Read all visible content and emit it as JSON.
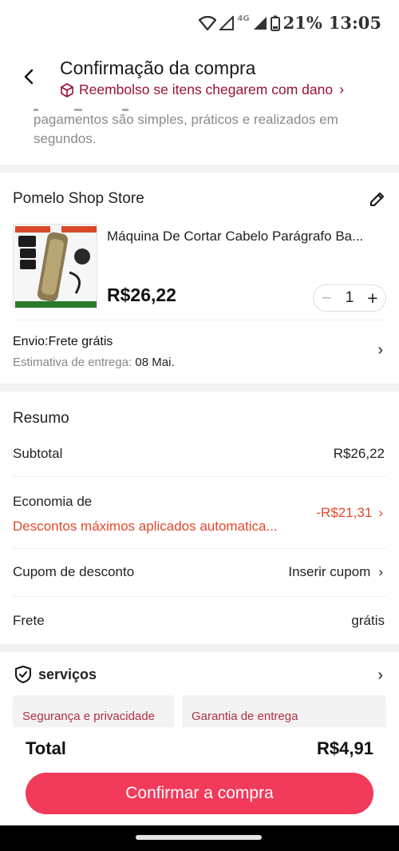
{
  "status_bar": {
    "network": "4G",
    "battery": "21%",
    "time": "13:05"
  },
  "header": {
    "title": "Confirmação da compra",
    "refund_notice": "Reembolso se itens chegarem com dano",
    "accent_color": "#9b1035"
  },
  "payment_info": {
    "text": "pagamentos são simples, práticos e realizados em segundos."
  },
  "store": {
    "name": "Pomelo Shop Store",
    "product": {
      "name": "Máquina De Cortar Cabelo Parágrafo Ba...",
      "price": "R$26,22",
      "quantity": "1"
    },
    "shipping": {
      "title": "Envio:Frete grátis",
      "estimate_label": "Estimativa de entrega:",
      "estimate_date": "08 Mai."
    }
  },
  "summary": {
    "title": "Resumo",
    "subtotal_label": "Subtotal",
    "subtotal_value": "R$26,22",
    "savings_label": "Economia de",
    "discount_text": "Descontos máximos aplicados automatica...",
    "discount_value": "-R$21,31",
    "coupon_label": "Cupom de desconto",
    "coupon_value": "Inserir cupom",
    "shipping_label": "Frete",
    "shipping_value": "grátis",
    "discount_color": "#e4472b"
  },
  "services": {
    "title": "serviços",
    "cards": [
      "Segurança e privacidade",
      "Garantia de entrega"
    ]
  },
  "footer": {
    "total_label": "Total",
    "total_value": "R$4,91",
    "confirm_label": "Confirmar a compra",
    "button_color": "#f23a5a"
  }
}
